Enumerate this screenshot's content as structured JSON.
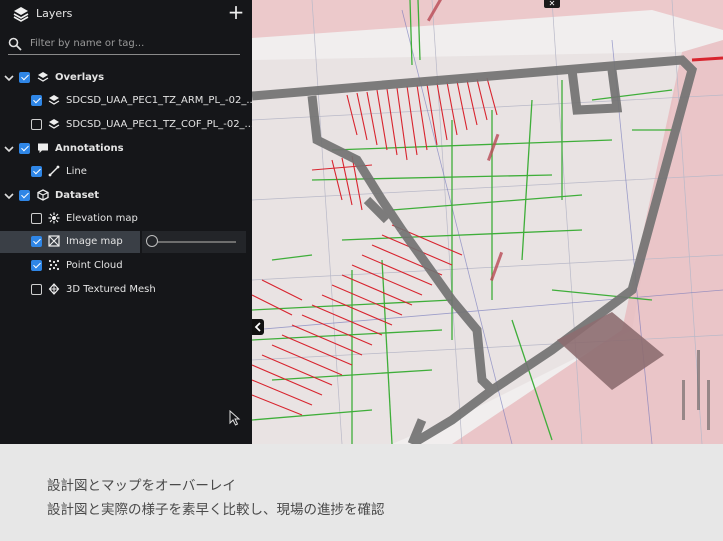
{
  "sidebar": {
    "header": {
      "title": "Layers",
      "add_button": "+"
    },
    "search": {
      "placeholder": "Filter by name or tag..."
    },
    "groups": {
      "overlays": {
        "label": "Overlays",
        "items": [
          {
            "label": "SDCSD_UAA_PEC1_TZ_ARM_PL_-02_...",
            "checked": true
          },
          {
            "label": "SDCSD_UAA_PEC1_TZ_COF_PL_-02_...",
            "checked": false
          }
        ]
      },
      "annotations": {
        "label": "Annotations",
        "items": [
          {
            "label": "Line",
            "checked": true
          }
        ]
      },
      "dataset": {
        "label": "Dataset",
        "items": [
          {
            "label": "Elevation map",
            "checked": false
          },
          {
            "label": "Image map",
            "checked": true,
            "selected": true
          },
          {
            "label": "Point Cloud",
            "checked": true
          },
          {
            "label": "3D Textured Mesh",
            "checked": false
          }
        ]
      }
    },
    "image_map_opacity": 0
  },
  "map": {
    "close_label": "✕"
  },
  "caption": {
    "line1": "設計図とマップをオーバーレイ",
    "line2": "設計図と実際の様子を素早く比較し、現場の進捗を確認"
  },
  "colors": {
    "sidebar_bg": "#151619",
    "accent_blue": "#2f86e6",
    "selected_row": "#3a3f46",
    "wall_gray": "#6f6f6f",
    "rebar_red": "#d8242e",
    "pipe_green": "#3fae3a",
    "caption_bg": "#e7e7e7"
  }
}
